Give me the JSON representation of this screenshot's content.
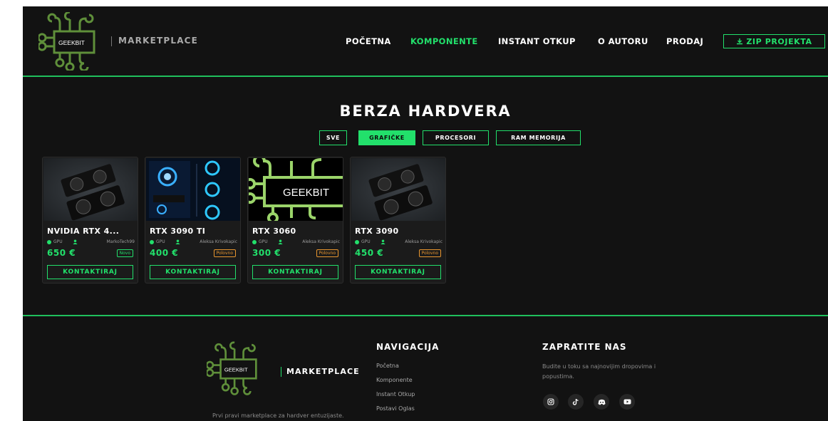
{
  "header": {
    "brand": "GEEKBIT",
    "subtitle": "MARKETPLACE",
    "nav": [
      "POČETNA",
      "KOMPONENTE",
      "INSTANT OTKUP",
      "O AUTORU",
      "PRODAJ"
    ],
    "active_nav": "KOMPONENTE",
    "zip_button": "ZIP PROJEKTA",
    "icons": {
      "zip": "download-icon"
    }
  },
  "main": {
    "title": "BERZA HARDVERA",
    "filters": [
      "SVE",
      "GRAFIČKE",
      "PROCESORI",
      "RAM MEMORIJA"
    ],
    "active_filter": "GRAFIČKE",
    "products": [
      {
        "title": "NVIDIA RTX 4...",
        "category": "GPU",
        "seller": "MarkoTech99",
        "price": "650 €",
        "condition": "Novo",
        "button": "KONTAKTIRAJ",
        "image": "gpu-photo"
      },
      {
        "title": "RTX 3090 TI",
        "category": "GPU",
        "seller": "Aleksa Krivokapic",
        "price": "400 €",
        "condition": "Polovno",
        "button": "KONTAKTIRAJ",
        "image": "pc-case-photo"
      },
      {
        "title": "RTX 3060",
        "category": "GPU",
        "seller": "Aleksa Krivokapic",
        "price": "300 €",
        "condition": "Polovno",
        "button": "KONTAKTIRAJ",
        "image": "geekbit-logo",
        "image_text": "GEEKBIT"
      },
      {
        "title": "RTX 3090",
        "category": "GPU",
        "seller": "Aleksa Krivokapic",
        "price": "450 €",
        "condition": "Polovno",
        "button": "KONTAKTIRAJ",
        "image": "gpu-photo"
      }
    ]
  },
  "footer": {
    "brand": "GEEKBIT",
    "subtitle": "MARKETPLACE",
    "tagline": "Prvi pravi marketplace za hardver entuzijaste.",
    "nav_heading": "NAVIGACIJA",
    "nav_links": [
      "Početna",
      "Komponente",
      "Instant Otkup",
      "Postavi Oglas"
    ],
    "follow_heading": "ZAPRATITE NAS",
    "follow_text": "Budite u toku sa najnovijim dropovima i popustima.",
    "social_icons": [
      "instagram-icon",
      "tiktok-icon",
      "discord-icon",
      "youtube-icon"
    ]
  },
  "colors": {
    "accent": "#22e06b",
    "background": "#121212",
    "card": "#1b1b1b",
    "used_badge": "#e8962f"
  }
}
